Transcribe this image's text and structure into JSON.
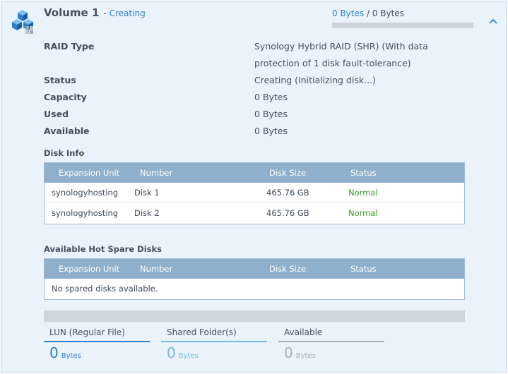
{
  "volume": {
    "name": "Volume 1",
    "separator": "-",
    "state": "Creating",
    "usage_used": "0 Bytes",
    "usage_rest": " / 0 Bytes",
    "usage_fraction": 0
  },
  "properties": [
    {
      "label": "RAID Type",
      "value": "Synology Hybrid RAID (SHR) (With data protection of 1 disk fault-tolerance)"
    },
    {
      "label": "Status",
      "value": "Creating (Initializing disk...)"
    },
    {
      "label": "Capacity",
      "value": "0 Bytes"
    },
    {
      "label": "Used",
      "value": "0 Bytes"
    },
    {
      "label": "Available",
      "value": "0 Bytes"
    }
  ],
  "disk_info": {
    "title": "Disk Info",
    "columns": [
      "Expansion Unit",
      "Number",
      "Disk Size",
      "Status"
    ],
    "rows": [
      [
        "synologyhosting",
        "Disk 1",
        "465.76 GB",
        "Normal"
      ],
      [
        "synologyhosting",
        "Disk 2",
        "465.76 GB",
        "Normal"
      ]
    ]
  },
  "hot_spare": {
    "title": "Available Hot Spare Disks",
    "columns": [
      "Expansion Unit",
      "Number",
      "Disk Size",
      "Status"
    ],
    "empty_message": "No spared disks available."
  },
  "summary": [
    {
      "label": "LUN (Regular File)",
      "value": "0",
      "unit": "Bytes",
      "color": "#2f7fc9",
      "line_color": "#2f7fc9"
    },
    {
      "label": "Shared Folder(s)",
      "value": "0",
      "unit": "Bytes",
      "color": "#74b9e6",
      "line_color": "#74b9e6"
    },
    {
      "label": "Available",
      "value": "0",
      "unit": "Bytes",
      "color": "#a9b0b7",
      "line_color": "#a9b0b7"
    }
  ],
  "icons": {
    "volume": "volume-cubes-icon",
    "collapse": "chevron-up-icon"
  }
}
